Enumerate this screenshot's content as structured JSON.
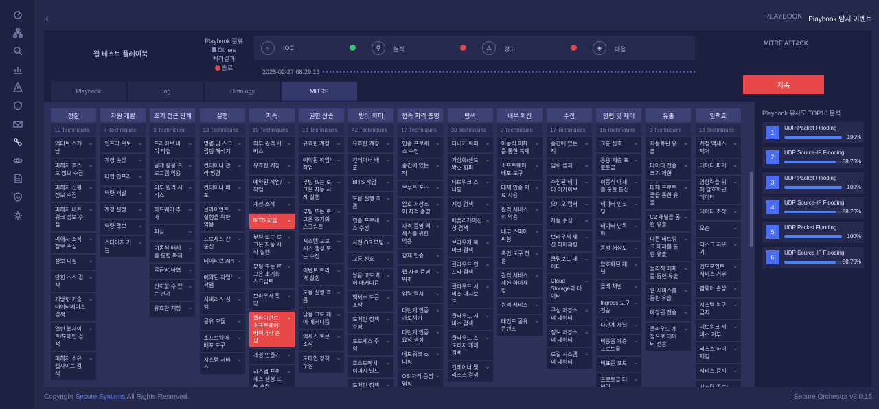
{
  "sidebar": {
    "icons": [
      "dashboard-icon",
      "network-icon",
      "search-icon",
      "chart-icon",
      "alert-triangle-icon",
      "shield-icon",
      "mail-icon",
      "playbook-icon",
      "eye-icon",
      "document-icon",
      "shield-check-icon",
      "gear-icon"
    ]
  },
  "breadcrumb": {
    "parent": "PLAYBOOK",
    "current": "Playbook 탐지 이벤트"
  },
  "playbook": {
    "name": "웹 테스트 플레이북",
    "category_label": "Playbook 분류",
    "category": "Others",
    "result_label": "처리결과",
    "result": "종료",
    "datetime": "2025-02-27 08:29:13"
  },
  "steps": [
    {
      "label": "IOC",
      "status": "ok"
    },
    {
      "label": "분석",
      "status": "fail"
    },
    {
      "label": "경고",
      "status": "fail"
    },
    {
      "label": "대응",
      "status": ""
    }
  ],
  "mitre_label": "MITRE ATT&CK",
  "continue_label": "지속",
  "tabs": [
    "Playbook",
    "Log",
    "Ontology",
    "MITRE"
  ],
  "active_tab": "MITRE",
  "tactics": [
    {
      "name": "정찰",
      "count": "10 Techniques",
      "items": [
        "액티브 스캐닝",
        "피해자 호스트 정보 수집",
        "피해자 신원 정보 수집",
        "피해자 네트워크 정보 수집",
        "피해자 조직 정보 수집",
        "정보 피싱",
        "단힌 소스 검색",
        "개방형 기술 데이터베이스 검색",
        "열린 웹사이트/도메인 검색",
        "피해자 소유 웹사이트 검색"
      ]
    },
    {
      "name": "자원 개발",
      "count": "7 Techniques",
      "items": [
        "인프라 확보",
        "계정 손상",
        "타협 인프라",
        "역량 개발",
        "계정 설정",
        "역량 확보",
        "스테이지 기능"
      ]
    },
    {
      "name": "초기 접근 단계",
      "count": "9 Techniques",
      "items": [
        "드라이브 바이 타협",
        "공개 응용 프로그램 악용",
        "외부 원격 서비스",
        "하드웨어 추가",
        "피싱",
        "이동식 매체를 통한 복제",
        "공급망 타협",
        "신뢰할 수 있는 관계",
        "유효한 계정"
      ]
    },
    {
      "name": "실행",
      "count": "13 Techniques",
      "items": [
        "명령 및 스크립팅 해석기",
        "컨테이너 관리 명령",
        "컨테이너 배포",
        "클라이언트 실행을 위한 악용",
        "프로세스 간 통신",
        "네이티브 API",
        "예약된 작업/작업",
        "서버리스 실행",
        "공유 모듈",
        "소프트웨어 배포 도구",
        "시스템 서비스"
      ]
    },
    {
      "name": "지속",
      "count": "19 Techniques",
      "items": [
        "외부 원격 서비스",
        "유효한 계정",
        "예약된 작업/작업",
        "계정 조작",
        "BITS 작업",
        "부팅 또는 로그온 자동 시작 실행",
        "부팅 또는 로그온 초기화 스크립트",
        "브라우저 확장",
        "클라이언트 소프트웨어 바이너리 손상",
        "계정 만들기",
        "시스템 프로세스 생성 또는 수정"
      ]
    },
    {
      "name": "권한 상승",
      "count": "13 Techniques",
      "items": [
        "유효한 계정",
        "예약된 작업/작업",
        "부팅 또는 로그온 자동 시작 실행",
        "부팅 또는 로그온 초기화 스크립트",
        "시스템 프로세스 생성 또는 수정",
        "이벤트 트리거 실행",
        "도용 실행 흐름",
        "남용 고도 제어 메커니즘",
        "액세스 토큰 조작",
        "도메인 정책 수정"
      ]
    },
    {
      "name": "방어 회피",
      "count": "42 Techniques",
      "items": [
        "유효한 계정",
        "컨테이너 배포",
        "BITS 작업",
        "도용 실행 흐름",
        "인증 프로세스 수정",
        "사전 OS 부팅",
        "교통 신호",
        "남용 고도 제어 메커니즘",
        "액세스 토큰 조작",
        "도메인 정책 수정",
        "프로세스 주입",
        "호스트에서 이미지 빌드",
        "도메인 정책 수정"
      ]
    },
    {
      "name": "접속 자격 증명",
      "count": "17 Techniques",
      "items": [
        "인증 프로세스 수정",
        "중간에 있는 적",
        "브루트 포스",
        "암호 저장소의 자격 증명",
        "자격 증명 액세스를 위한 악용",
        "강제 인증",
        "웹 자격 증명 위조",
        "입력 캡처",
        "다단계 인증 가로채기",
        "다단계 인증 요청 생성",
        "네트워크 스니핑",
        "OS 자격 증명 덤핑"
      ]
    },
    {
      "name": "탐색",
      "count": "30 Techniques",
      "items": [
        "디버거 회피",
        "가상화/샌드박스 회피",
        "네트워크 스니핑",
        "계정 검색",
        "애플리케이션 창 검색",
        "브라우저 북마크 검색",
        "클라우드 인프라 검색",
        "클라우드 서비스 대시보드",
        "클라우드 서비스 검색",
        "클라우드 스토리지 개체 검색",
        "컨테이너 및 리소스 검색"
      ]
    },
    {
      "name": "내부 확산",
      "count": "9 Techniques",
      "items": [
        "이동식 매체를 통한 복제",
        "소프트웨어 배포 도구",
        "대체 인증 자료 사용",
        "원격 서비스의 악용",
        "내부 스피어피싱",
        "측면 도구 전송",
        "원격 서비스 세션 하이재킹",
        "원격 서비스",
        "테인트 공유 콘텐츠"
      ]
    },
    {
      "name": "수집",
      "count": "17 Techniques",
      "items": [
        "중간에 있는 적",
        "입력 캡처",
        "수집된 데이터 아카이브",
        "오디오 캡처",
        "자동 수집",
        "브라우저 세션 하이재킹",
        "클립보드 데이터",
        "Cloud Storage의 데이터",
        "구성 저장소의 데이터",
        "정보 저장소의 데이터",
        "로컬 시스템의 데이터"
      ]
    },
    {
      "name": "명령 및 제어",
      "count": "16 Techniques",
      "items": [
        "교통 신호",
        "응용 계층 프로토콜",
        "이동식 매체를 통한 통신",
        "데이터 인코딩",
        "데이터 난독화",
        "동적 해상도",
        "암호화된 채널",
        "폴백 채널",
        "Ingress 도구 전송",
        "다단계 채널",
        "비응용 계층 프로토콜",
        "비표준 포트",
        "프로토콜 터널링"
      ]
    },
    {
      "name": "유출",
      "count": "9 Techniques",
      "items": [
        "자동화된 유출",
        "데이터 전송 크기 제한",
        "대체 프로토콜을 통한 유출",
        "C2 채널을 통한 유출",
        "다른 네트워크 매체를 통한 유출",
        "물리적 매체를 통한 유출",
        "웹 서비스를 통한 유출",
        "예정된 전송",
        "클라우드 계정으로 데이터 전송"
      ]
    },
    {
      "name": "임팩트",
      "count": "13 Techniques",
      "items": [
        "계정 액세스 제거",
        "데이터 파기",
        "영향력을 위해 암호화된 데이터",
        "데이터 조작",
        "오손",
        "디스크 지우기",
        "엔드포인트 서비스 거부",
        "펌웨어 손상",
        "시스템 복구 금지",
        "네트워크 서비스 거부",
        "리소스 하이재킹",
        "서비스 중지",
        "시스템 종료/재부팅"
      ]
    }
  ],
  "hot_items": [
    "지속/4",
    "지속/8"
  ],
  "top10": {
    "title": "Playbook 유사도 TOP10 분석",
    "items": [
      {
        "rank": "1",
        "name": "UDP Packet Flooding",
        "pct": "100%",
        "value": 1.0
      },
      {
        "rank": "2",
        "name": "UDP Source-IP Flooding",
        "pct": "88.76%",
        "value": 0.8876
      },
      {
        "rank": "3",
        "name": "UDP Packet Flooding",
        "pct": "100%",
        "value": 1.0
      },
      {
        "rank": "4",
        "name": "UDP Source-IP Flooding",
        "pct": "88.76%",
        "value": 0.8876
      },
      {
        "rank": "5",
        "name": "UDP Packet Flooding",
        "pct": "100%",
        "value": 1.0
      },
      {
        "rank": "6",
        "name": "UDP Source-IP Flooding",
        "pct": "88.76%",
        "value": 0.8876
      }
    ]
  },
  "footer": {
    "prefix": "Copyright ",
    "company": "Secure Systems",
    "suffix": " All Rights Reserved.",
    "version": "Secure Orchestra v3.0.15"
  }
}
